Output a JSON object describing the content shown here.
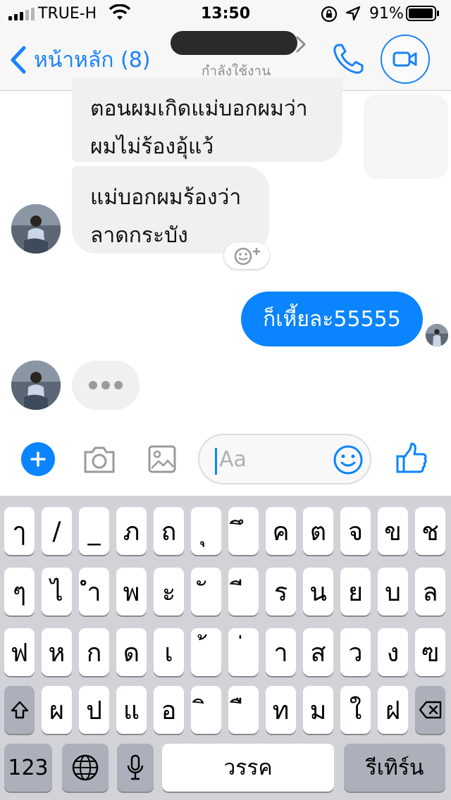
{
  "status_bar": {
    "carrier": "TRUE-H",
    "time": "13:50",
    "battery_percent": "91%",
    "icons": [
      "signal-icon",
      "wifi-icon",
      "rotation-lock-icon",
      "location-arrow-icon",
      "battery-icon"
    ]
  },
  "header": {
    "back_label": "หน้าหลัก (8)",
    "contact_status": "กำลังใช้งาน",
    "icons": [
      "chevron-left-icon",
      "chevron-right-icon",
      "phone-icon",
      "video-camera-icon"
    ]
  },
  "messages": [
    {
      "direction": "incoming",
      "lines": [
        "ตอนผมเกิดแม่บอกผมว่า",
        "ผมไม่ร้องอุ้แว้"
      ]
    },
    {
      "direction": "incoming",
      "lines": [
        "แม่บอกผมร้องว่า",
        "ลาดกระบัง"
      ]
    },
    {
      "direction": "outgoing",
      "text": "ก็เหี้ยละ55555"
    }
  ],
  "composer": {
    "placeholder": "Aa",
    "value": "",
    "icons": [
      "plus-icon",
      "camera-icon",
      "image-icon",
      "emoji-icon",
      "thumbs-up-icon"
    ]
  },
  "keyboard": {
    "row1": [
      "ๅ",
      "/",
      "_",
      "ภ",
      "ถ",
      "ุ",
      "ึ",
      "ค",
      "ต",
      "จ",
      "ข",
      "ช"
    ],
    "row2": [
      "ๆ",
      "ไ",
      "ำ",
      "พ",
      "ะ",
      "ั",
      "ี",
      "ร",
      "น",
      "ย",
      "บ",
      "ล"
    ],
    "row3": [
      "ฟ",
      "ห",
      "ก",
      "ด",
      "เ",
      "้",
      "่",
      "า",
      "ส",
      "ว",
      "ง",
      "ฃ"
    ],
    "row4": [
      "ผ",
      "ป",
      "แ",
      "อ",
      "ิ",
      "ื",
      "ท",
      "ม",
      "ใ",
      "ฝ"
    ],
    "numbers_label": "123",
    "space_label": "วรรค",
    "return_label": "รีเทิร์น",
    "icons": [
      "shift-icon",
      "backspace-icon",
      "globe-icon",
      "microphone-icon"
    ]
  },
  "colors": {
    "accent": "#0a84ff",
    "incoming_bubble": "#f1f0f0",
    "keyboard_bg": "#d1d3d9"
  }
}
